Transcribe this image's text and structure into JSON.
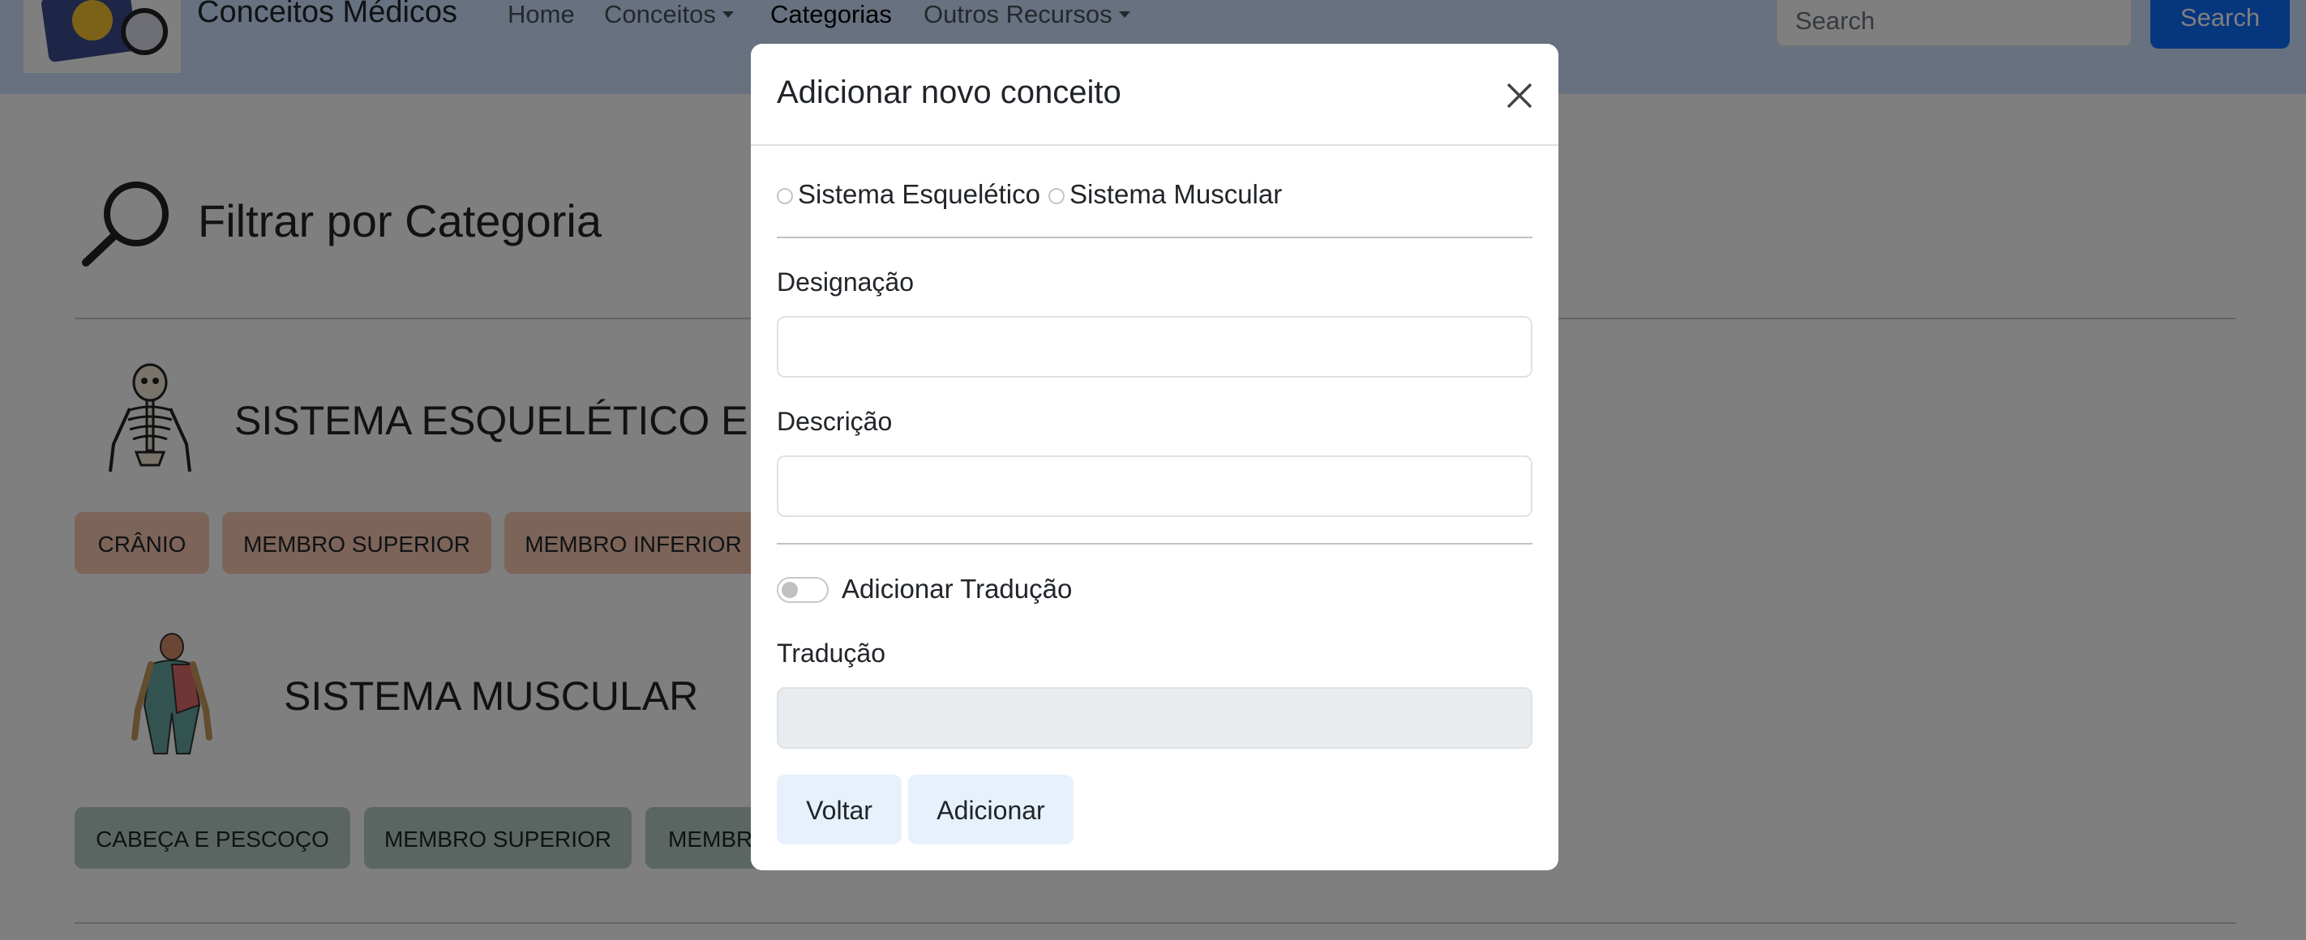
{
  "navbar": {
    "brand": "Conceitos Médicos",
    "links": {
      "home": "Home",
      "conceitos": "Conceitos",
      "categorias": "Categorias",
      "outros": "Outros Recursos"
    },
    "search_placeholder": "Search",
    "search_button": "Search"
  },
  "page": {
    "filter_title": "Filtrar por Categoria",
    "sections": {
      "skeletal": {
        "title": "SISTEMA ESQUELÉTICO E AR",
        "chips": [
          "CRÂNIO",
          "MEMBRO SUPERIOR",
          "MEMBRO INFERIOR"
        ]
      },
      "muscular": {
        "title": "SISTEMA MUSCULAR",
        "chips": [
          "CABEÇA E PESCOÇO",
          "MEMBRO SUPERIOR",
          "MEMBR"
        ]
      }
    }
  },
  "modal": {
    "title": "Adicionar novo conceito",
    "radio_options": [
      "Sistema Esquelético",
      "Sistema Muscular"
    ],
    "designacao_label": "Designação",
    "designacao_value": "",
    "descricao_label": "Descrição",
    "descricao_value": "",
    "toggle_label": "Adicionar Tradução",
    "toggle_on": false,
    "traducao_label": "Tradução",
    "traducao_value": "",
    "back_button": "Voltar",
    "add_button": "Adicionar"
  },
  "colors": {
    "navbar_bg": "#cfe2ff",
    "search_button_bg": "#0d6efd",
    "skeletal_chip_bg": "#f9c8b3",
    "muscular_chip_bg": "#b6ccc6",
    "modal_button_bg": "#e7f1fb"
  }
}
